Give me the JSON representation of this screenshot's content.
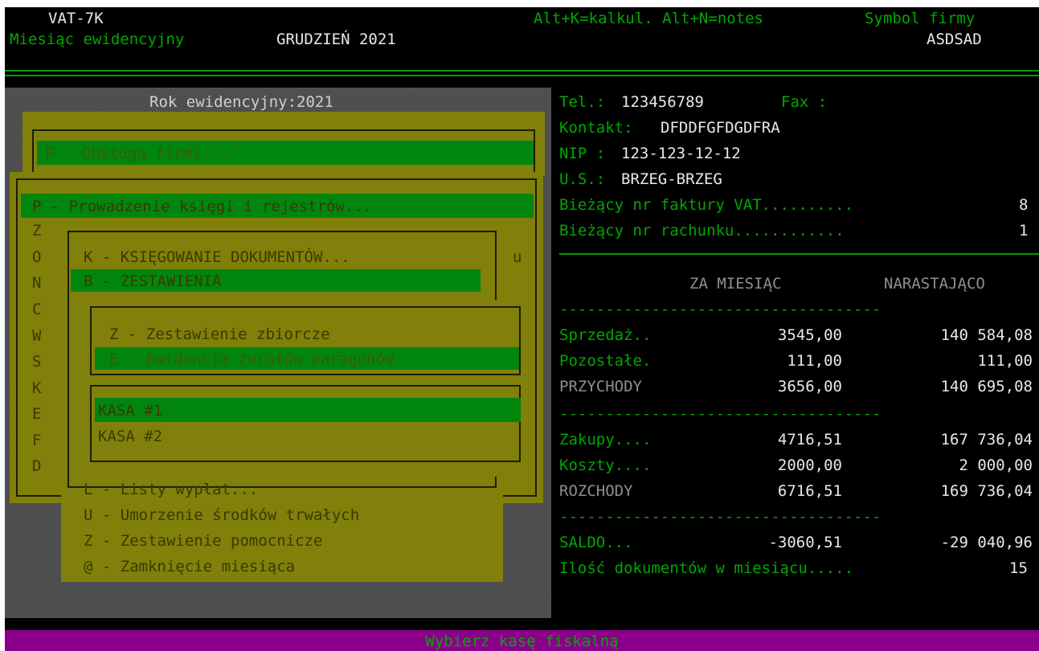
{
  "header": {
    "app_title": "VAT-7K",
    "month_label": "Miesiąc ewidencyjny",
    "month_value": "GRUDZIEŃ 2021",
    "shortcuts": "Alt+K=kalkul. Alt+N=notes",
    "company_symbol_label": "Symbol firmy",
    "company_symbol_value": "ASDSAD"
  },
  "year_bar": "Rok ewidencyjny:2021",
  "menu_main": {
    "firm": "F - Obsługa firmy..."
  },
  "menu_books": {
    "selected": "P - Prowadzenie księgi i rejestrów...",
    "letters": [
      "Z",
      "O",
      "N",
      "C",
      "W",
      "S",
      "K",
      "E",
      "F",
      "D"
    ]
  },
  "menu_books_sub": {
    "items": [
      "K - KSIĘGOWANIE DOKUMENTÓW...",
      "B - ZESTAWIENIA",
      "L - Listy wypłat...",
      "U - Umorzenie środków trwałych",
      "Z - Zestawienie pomocnicze",
      "@ - Zamknięcie miesiąca"
    ],
    "right_letter": "u"
  },
  "menu_reports": {
    "items": [
      "Z - Zestawienie zbiorcze",
      "E - Ewidencja zwrotów paragonów"
    ]
  },
  "menu_register": {
    "items": [
      "KASA #1",
      "KASA #2"
    ]
  },
  "info": {
    "tel_label": "Tel.:",
    "tel_value": "123456789",
    "fax_label": "Fax :",
    "contact_label": "Kontakt:",
    "contact_value": "DFDDFGFDGDFRA",
    "nip_label": "NIP :",
    "nip_value": "123-123-12-12",
    "us_label": "U.S.:",
    "us_value": "BRZEG-BRZEG",
    "invoice_label": "Bieżący nr faktury VAT..........",
    "invoice_value": "8",
    "bill_label": "Bieżący nr rachunku............",
    "bill_value": "1"
  },
  "summary": {
    "col_month": "ZA MIESIĄC",
    "col_cumulative": "NARASTAJĄCO",
    "separator": "-----------------------------------",
    "rows": [
      {
        "label": "Sprzedaż..",
        "month": "3545,00",
        "cum": "140 584,08"
      },
      {
        "label": "Pozostałe.",
        "month": "111,00",
        "cum": "111,00"
      },
      {
        "label": "PRZYCHODY",
        "month": "3656,00",
        "cum": "140 695,08"
      },
      {
        "label": "Zakupy....",
        "month": "4716,51",
        "cum": "167 736,04"
      },
      {
        "label": "Koszty....",
        "month": "2000,00",
        "cum": "2 000,00"
      },
      {
        "label": "ROZCHODY",
        "month": "6716,51",
        "cum": "169 736,04"
      },
      {
        "label": "SALDO...",
        "month": "-3060,51",
        "cum": "-29 040,96"
      }
    ],
    "docs_label": "Ilość dokumentów w miesiącu.....",
    "docs_value": "15"
  },
  "status_bar": "Wybierz kasę fiskalną",
  "colors": {
    "background": "#000000",
    "green_text": "#00a800",
    "menu_olive": "#80800a",
    "highlight_bar": "#00860f",
    "status_bar": "#8b008b"
  }
}
